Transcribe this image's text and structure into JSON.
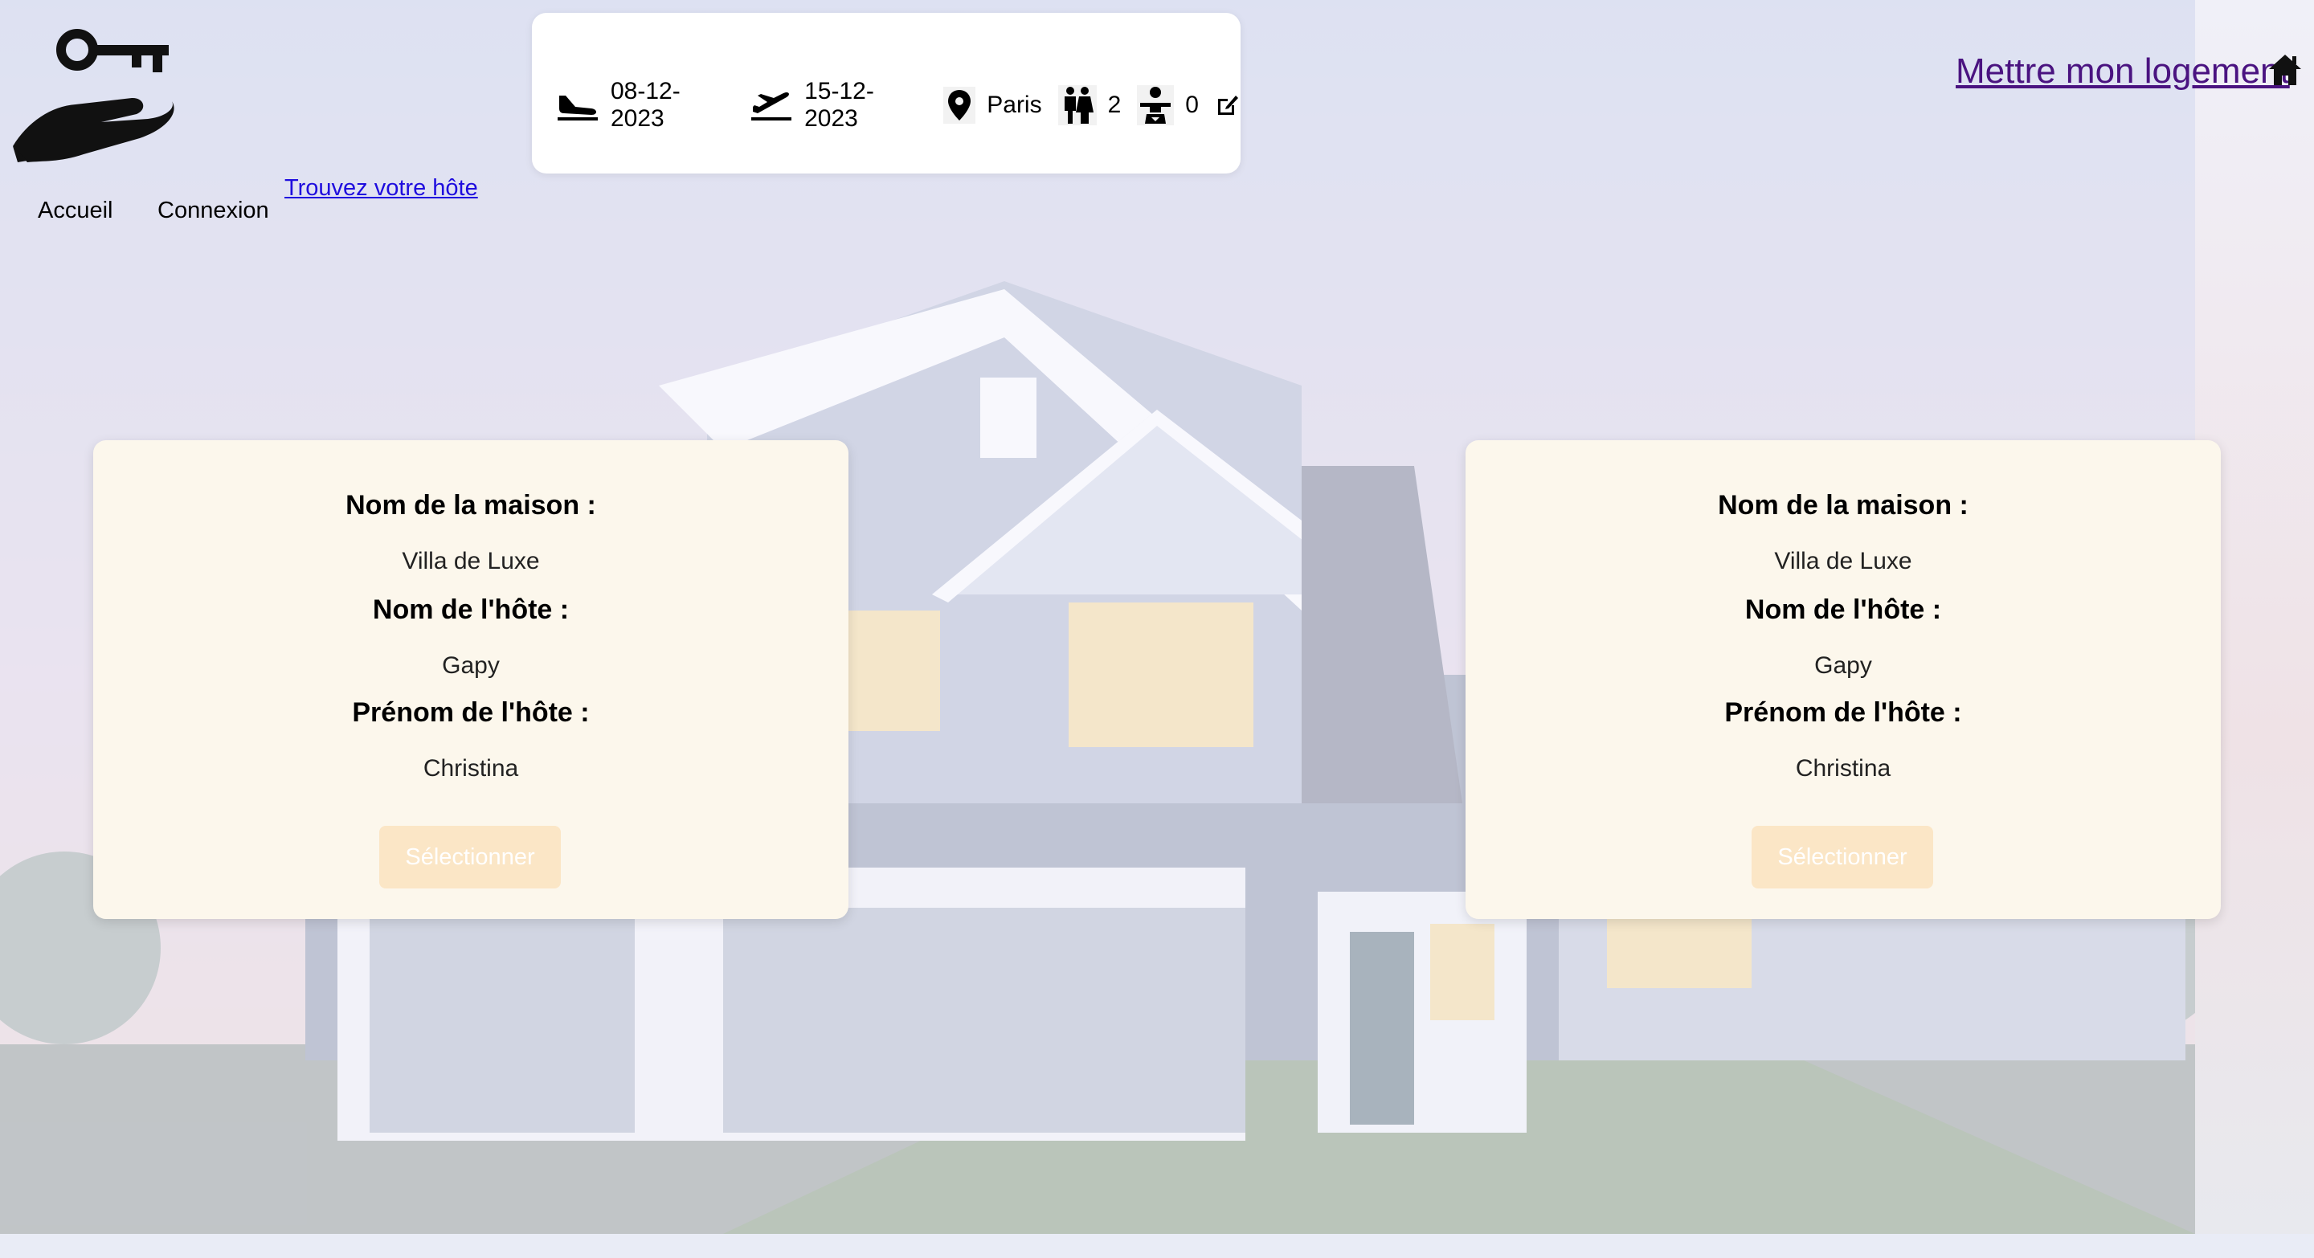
{
  "nav": {
    "logo_icon": "key-on-hand-icon",
    "items": [
      {
        "label": "Accueil"
      },
      {
        "label": "Connexion"
      }
    ],
    "find_host_link": "Trouvez votre hôte"
  },
  "search": {
    "arrival_icon": "plane-landing-icon",
    "arrival_date": "08-12-2023",
    "departure_icon": "plane-takeoff-icon",
    "departure_date": "15-12-2023",
    "location_icon": "map-pin-icon",
    "location": "Paris",
    "adults_icon": "adults-icon",
    "adults": "2",
    "children_icon": "baby-icon",
    "children": "0",
    "edit_icon": "edit-icon"
  },
  "header_right": {
    "list_home_link": "Mettre mon logement ",
    "home_icon": "home-icon"
  },
  "cards": [
    {
      "house_label": "Nom de la maison :",
      "house_name": "Villa de Luxe",
      "host_name_label": "Nom de l'hôte :",
      "host_name": "Gapy",
      "host_firstname_label": "Prénom de l'hôte :",
      "host_firstname": "Christina",
      "select_button": "Sélectionner"
    },
    {
      "house_label": "Nom de la maison :",
      "house_name": "Villa de Luxe",
      "host_name_label": "Nom de l'hôte :",
      "host_name": "Gapy",
      "host_firstname_label": "Prénom de l'hôte :",
      "host_firstname": "Christina",
      "select_button": "Sélectionner"
    }
  ],
  "colors": {
    "card_background": "#fcf7ec",
    "button_background": "#fbe6c6",
    "link_blue": "#1f0dde",
    "link_purple": "#4a1380"
  }
}
